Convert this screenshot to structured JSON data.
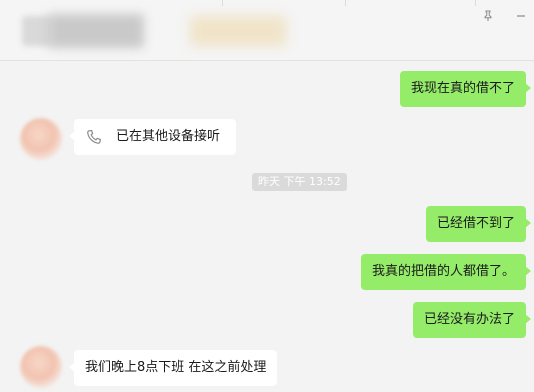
{
  "header": {
    "pin_icon": "pin-icon",
    "minimize_icon": "minimize-icon"
  },
  "messages": [
    {
      "direction": "out",
      "text": "我现在真的借不了"
    },
    {
      "direction": "in",
      "type": "call",
      "icon": "phone-icon",
      "text": "已在其他设备接听"
    },
    {
      "direction": "out",
      "text": "已经借不到了"
    },
    {
      "direction": "out",
      "text": "我真的把借的人都借了。"
    },
    {
      "direction": "out",
      "text": "已经没有办法了"
    },
    {
      "direction": "in",
      "text": "我们晚上8点下班  在这之前处理"
    }
  ],
  "timestamp": "昨天 下午 13:52",
  "colors": {
    "outgoing_bubble": "#95ec69",
    "incoming_bubble": "#ffffff",
    "background": "#f3f3f3",
    "timestamp_bg": "#dadada"
  }
}
